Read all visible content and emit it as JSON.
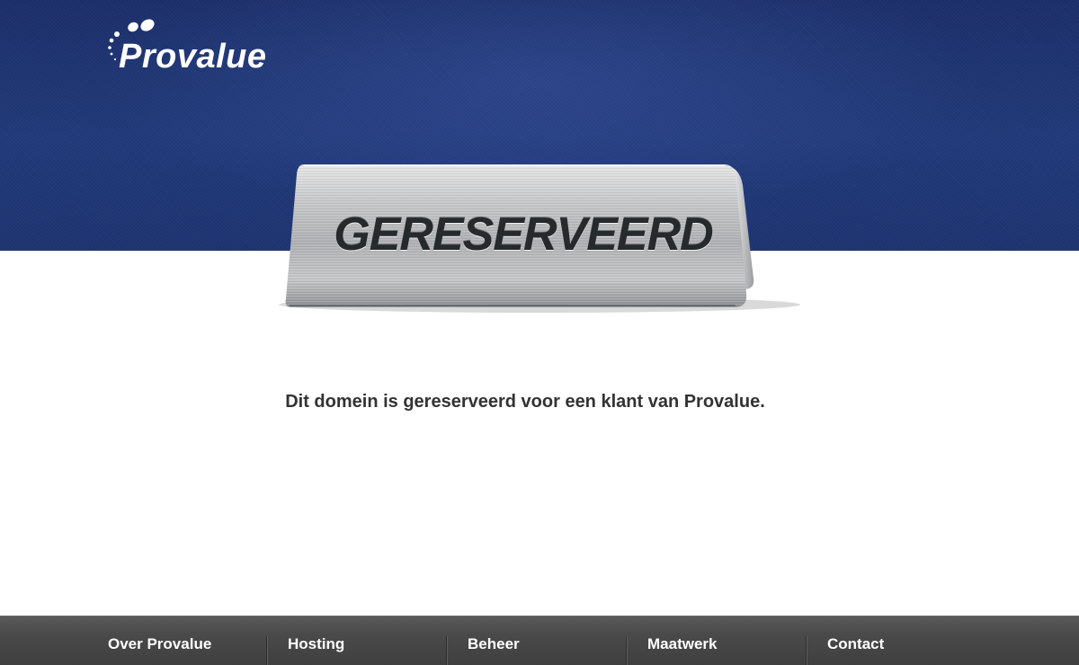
{
  "header": {
    "logo_text": "Provalue",
    "background_color": "#213a7a"
  },
  "sign": {
    "text": "GERESERVEERD"
  },
  "main": {
    "message": "Dit domein is gereserveerd voor een klant van Provalue."
  },
  "footer": {
    "nav_items": [
      {
        "label": "Over Provalue"
      },
      {
        "label": "Hosting"
      },
      {
        "label": "Beheer"
      },
      {
        "label": "Maatwerk"
      },
      {
        "label": "Contact"
      }
    ],
    "background_color": "#4a4a4a"
  }
}
